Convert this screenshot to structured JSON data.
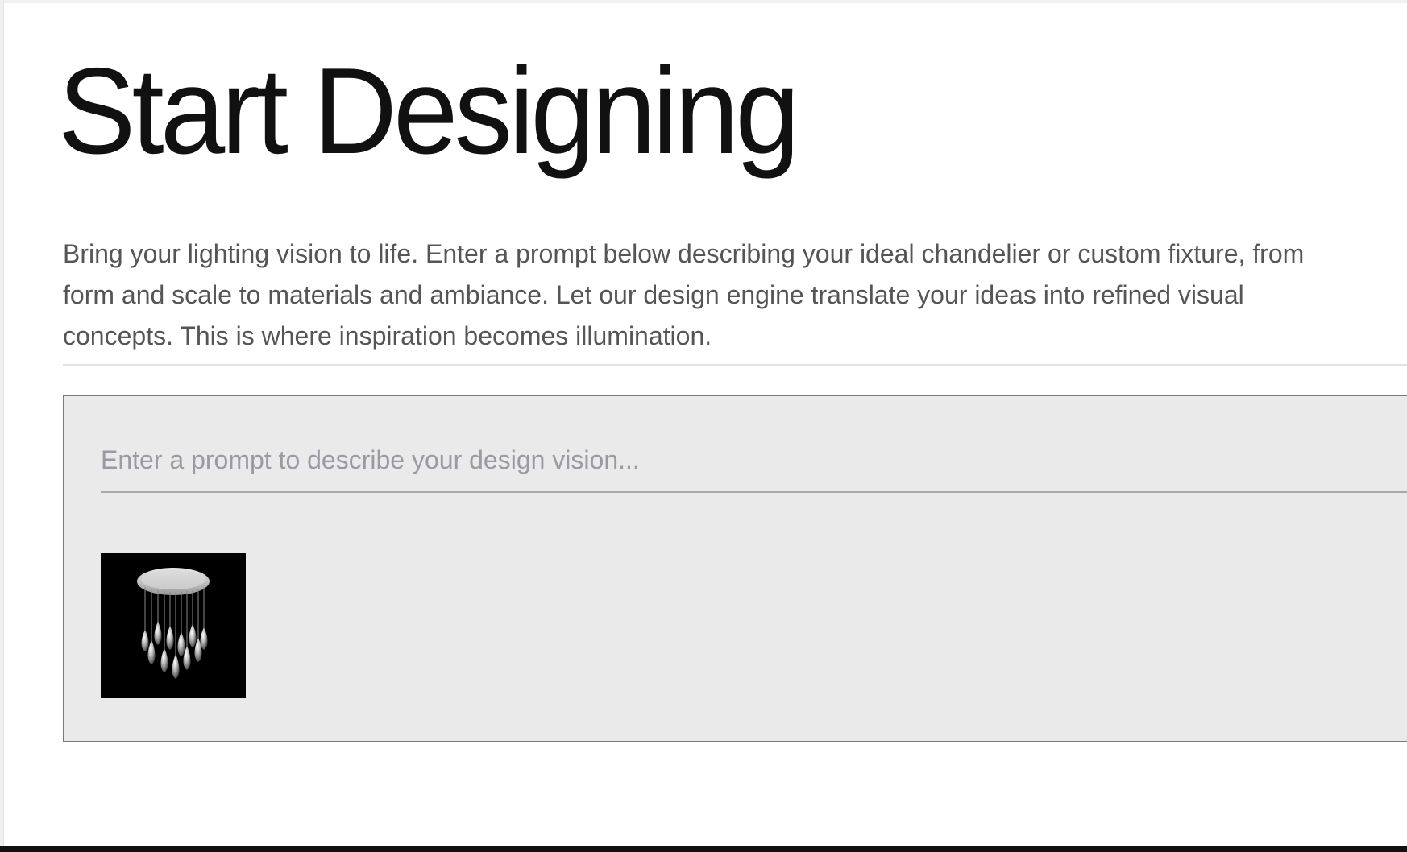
{
  "header": {
    "title": "Start Designing"
  },
  "intro": {
    "text": "Bring your lighting vision to life. Enter a prompt below describing your ideal chandelier or custom fixture, from form and scale to materials and ambiance. Let our design engine translate your ideas into refined visual concepts. This is where inspiration becomes illumination."
  },
  "composer": {
    "prompt_placeholder": "Enter a prompt to describe your design vision...",
    "prompt_value": "",
    "attachment": {
      "icon": "chandelier-image",
      "background": "#000000"
    }
  },
  "colors": {
    "title_text": "#111111",
    "body_text": "#555555",
    "composer_bg": "#eaeaea",
    "composer_border": "#7a7a7a",
    "placeholder": "#9a9aa3"
  }
}
